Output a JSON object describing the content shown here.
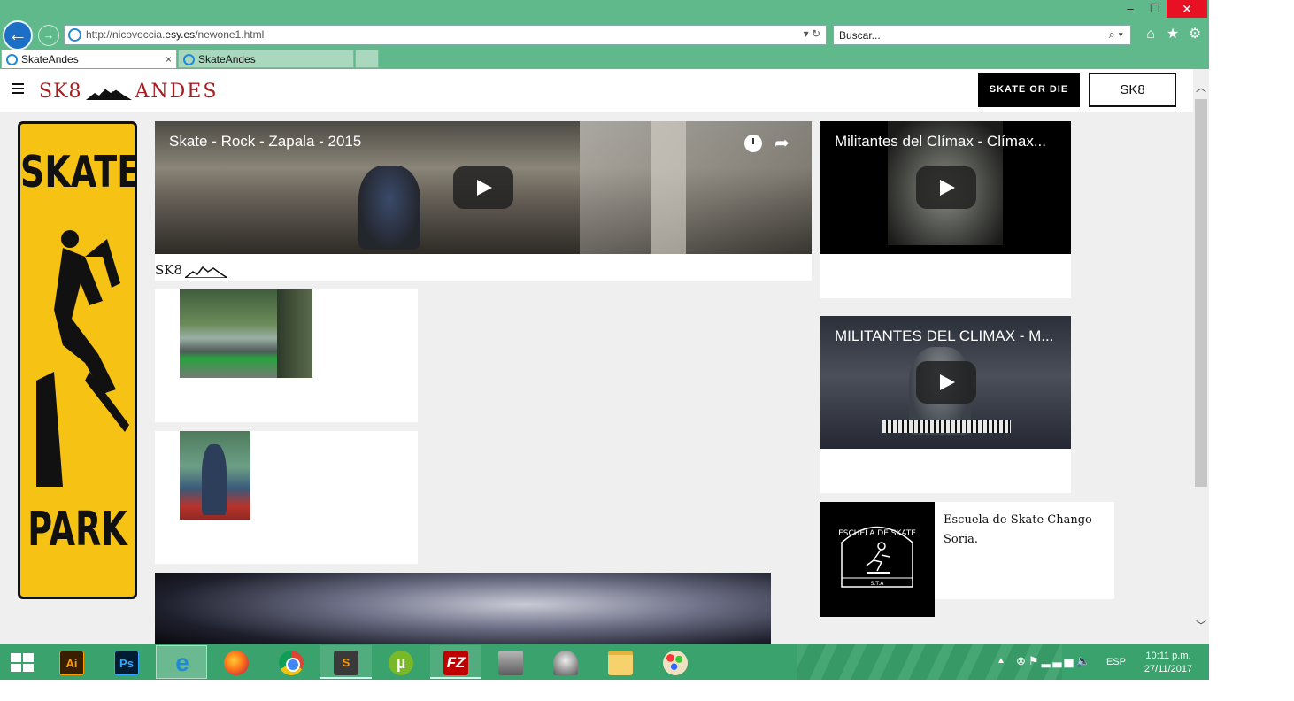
{
  "window": {
    "min_icon": "minimize-icon",
    "max_icon": "restore-icon",
    "close_glyph": "✕"
  },
  "browser": {
    "address_prefix": "http://nicovoccia.",
    "address_domain": "esy.es",
    "address_path": "/newone1.html",
    "search_placeholder": "Buscar...",
    "tabs": [
      {
        "label": "SkateAndes",
        "active": true
      },
      {
        "label": "SkateAndes",
        "active": false
      }
    ],
    "tab_close": "×"
  },
  "site": {
    "logo_left": "SK8",
    "logo_right": "ANDES",
    "nav_skate_or_die": "SKATE OR DIE",
    "nav_sk8": "SK8",
    "sign_top": "SKATE",
    "sign_bottom": "PARK",
    "caption": "SK8"
  },
  "videos": {
    "main_title": "Skate - Rock - Zapala - 2015",
    "climax1_title": "Militantes del Clímax - Clímax...",
    "climax2_title": "MILITANTES DEL CLIMAX - M..."
  },
  "school": {
    "text": "Escuela de Skate Chango Soria.",
    "emblem_top": "ESCUELA DE SKATE",
    "emblem_bottom": "S.T.A"
  },
  "taskbar": {
    "apps": [
      "Ai",
      "Ps",
      "e",
      "",
      "",
      "S",
      "µ",
      "FZ",
      "",
      "",
      "",
      ""
    ],
    "lang": "ESP",
    "time": "10:11 p.m.",
    "date": "27/11/2017"
  },
  "colors": {
    "chrome_green": "#5fb98b",
    "taskbar_green": "#3aa26c",
    "logo_red": "#a91d22",
    "sign_yellow": "#f6c314"
  }
}
